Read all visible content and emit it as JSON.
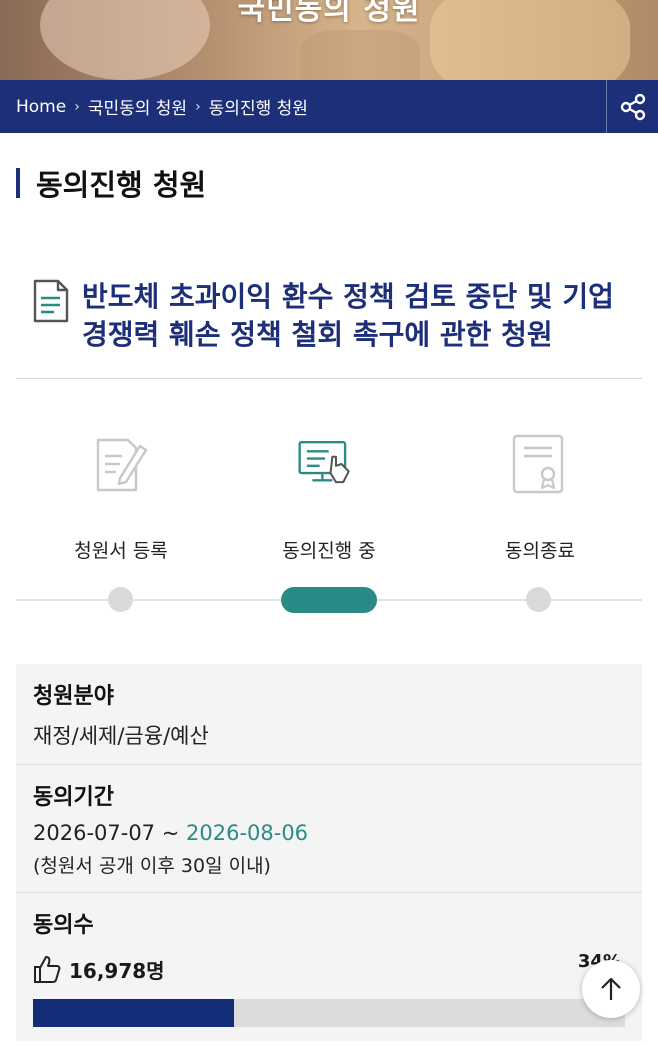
{
  "hero": {
    "title": "국민동의 청원"
  },
  "breadcrumb": {
    "items": [
      "Home",
      "국민동의 청원",
      "동의진행 청원"
    ]
  },
  "page": {
    "title": "동의진행 청원"
  },
  "petition": {
    "title": "반도체 초과이익 환수 정책 검토 중단 및 기업 경쟁력 훼손 정책 철회 촉구에 관한 청원"
  },
  "steps": [
    {
      "label": "청원서 등록",
      "icon": "document-pen-icon",
      "state": "inactive"
    },
    {
      "label": "동의진행 중",
      "icon": "computer-click-icon",
      "state": "active"
    },
    {
      "label": "동의종료",
      "icon": "certificate-icon",
      "state": "inactive"
    }
  ],
  "info": {
    "field": {
      "label": "청원분야",
      "value": "재정/세제/금융/예산"
    },
    "period": {
      "label": "동의기간",
      "start": "2026-07-07 ~ ",
      "end": "2026-08-06",
      "note": "(청원서 공개 이후 30일 이내)"
    },
    "count": {
      "label": "동의수",
      "value": "16,978명",
      "percent_label": "34%",
      "percent": 0.34
    }
  },
  "colors": {
    "brand_navy": "#1c2f78",
    "accent_teal": "#2a8b86",
    "bar_fill": "#142d78"
  }
}
